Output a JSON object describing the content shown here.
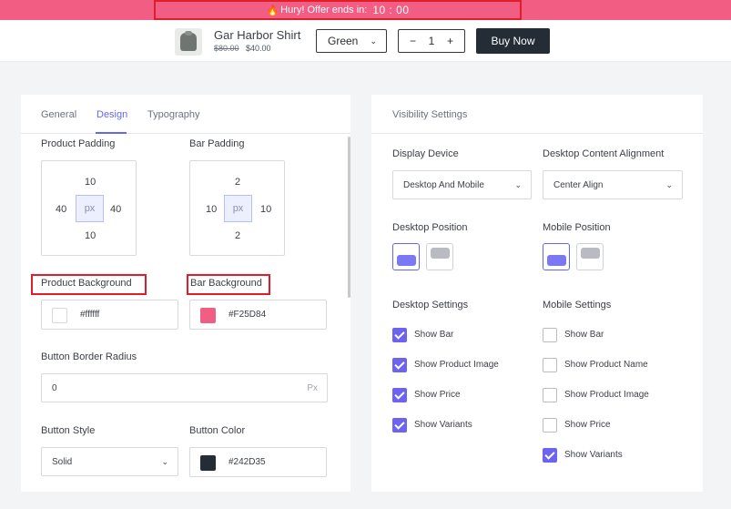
{
  "offer": {
    "fire_icon": "🔥",
    "text": "Hury! Offer ends in:",
    "timer": "10 : 00",
    "bg_color": "#F25D84"
  },
  "product": {
    "name": "Gar Harbor Shirt",
    "old_price": "$80.00",
    "new_price": "$40.00",
    "variant": "Green",
    "quantity": "1",
    "minus": "−",
    "plus": "+",
    "buy_label": "Buy Now",
    "image_icon": "shirt-icon"
  },
  "left_panel": {
    "tabs": [
      {
        "label": "General"
      },
      {
        "label": "Design"
      },
      {
        "label": "Typography"
      }
    ],
    "active_tab": "Design",
    "product_padding": {
      "label": "Product Padding",
      "top": "10",
      "left": "40",
      "right": "40",
      "bottom": "10",
      "unit": "px"
    },
    "bar_padding": {
      "label": "Bar Padding",
      "top": "2",
      "left": "10",
      "right": "10",
      "bottom": "2",
      "unit": "px"
    },
    "product_background": {
      "label": "Product Background",
      "value": "#ffffff",
      "color": "#ffffff"
    },
    "bar_background": {
      "label": "Bar Background",
      "value": "#F25D84",
      "color": "#F25D84"
    },
    "button_border_radius": {
      "label": "Button Border Radius",
      "value": "0",
      "unit": "Px"
    },
    "button_style": {
      "label": "Button Style",
      "value": "Solid"
    },
    "button_color": {
      "label": "Button Color",
      "value": "#242D35",
      "color": "#242D35"
    }
  },
  "right_panel": {
    "title": "Visibility Settings",
    "display_device": {
      "label": "Display Device",
      "value": "Desktop And Mobile"
    },
    "desktop_content_alignment": {
      "label": "Desktop Content Alignment",
      "value": "Center Align"
    },
    "desktop_position": {
      "label": "Desktop Position",
      "selected": "top"
    },
    "mobile_position": {
      "label": "Mobile Position",
      "selected": "top"
    },
    "desktop_settings": {
      "label": "Desktop Settings",
      "items": [
        {
          "label": "Show Bar",
          "checked": true
        },
        {
          "label": "Show Product Image",
          "checked": true
        },
        {
          "label": "Show Price",
          "checked": true
        },
        {
          "label": "Show Variants",
          "checked": true
        }
      ]
    },
    "mobile_settings": {
      "label": "Mobile Settings",
      "items": [
        {
          "label": "Show Bar",
          "checked": false
        },
        {
          "label": "Show Product Name",
          "checked": false
        },
        {
          "label": "Show Product Image",
          "checked": false
        },
        {
          "label": "Show Price",
          "checked": false
        },
        {
          "label": "Show Variants",
          "checked": true
        }
      ]
    }
  },
  "colors": {
    "accent": "#6366F1",
    "checkbox": "#6C63F0",
    "dark": "#242D35",
    "highlight_outline": "#E11D2A"
  }
}
